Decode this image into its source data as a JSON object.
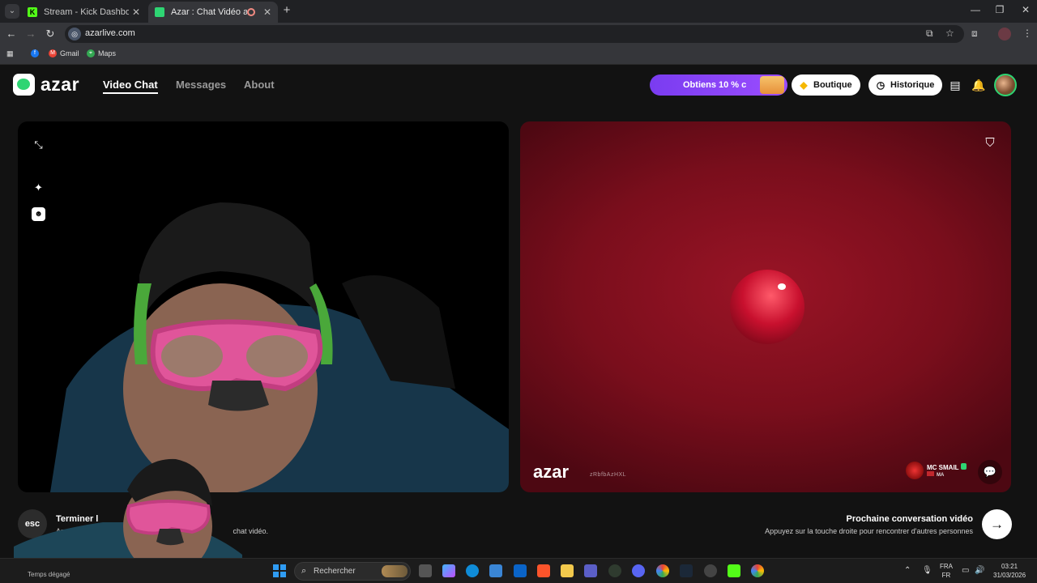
{
  "browser": {
    "tabs": [
      {
        "title": "Stream - Kick Dashboard",
        "color": "#53fc18",
        "fav": "K"
      },
      {
        "title": "Azar : Chat Vidéo avec de n",
        "color": "#2ed573",
        "fav": ""
      }
    ],
    "url": "azarlive.com",
    "bookmarks": [
      {
        "label": "",
        "color": "#1877f2",
        "icon": "facebook-icon"
      },
      {
        "label": "Gmail",
        "color": "#ea4335",
        "icon": "gmail-icon"
      },
      {
        "label": "Maps",
        "color": "#34a853",
        "icon": "maps-icon"
      }
    ]
  },
  "app": {
    "logo": "azar",
    "nav": [
      {
        "label": "Video Chat",
        "active": true
      },
      {
        "label": "Messages",
        "active": false
      },
      {
        "label": "About",
        "active": false
      }
    ],
    "promo": "Obtiens 10 % c",
    "boutique": "Boutique",
    "historique": "Historique",
    "accent": "#2ed573",
    "promo_color": "#8b45f7"
  },
  "remote": {
    "watermark": "azar",
    "watermark_id": "zRbfbAzHXL",
    "peer_name": "MC SMAIL",
    "peer_country": "MA"
  },
  "bottom": {
    "esc_label": "esc",
    "end_title": "Terminer l",
    "end_sub_left": "Appuy",
    "end_sub_right": "chat vidéo.",
    "next_title": "Prochaine conversation vidéo",
    "next_sub": "Appuyez sur la touche droite pour rencontrer d'autres personnes"
  },
  "taskbar": {
    "weather": "Temps dégagé",
    "search_placeholder": "Rechercher",
    "lang_top": "FRA",
    "lang_bottom": "FR",
    "time": "03:21",
    "date": "31/03/2026"
  }
}
